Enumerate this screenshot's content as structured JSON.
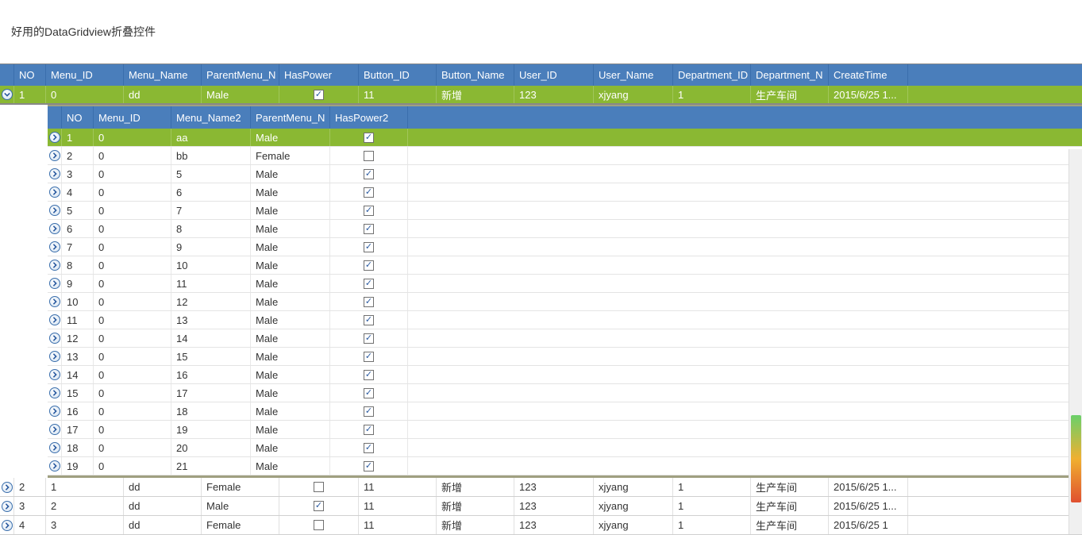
{
  "title": "好用的DataGridview折叠控件",
  "main_columns": {
    "no": "NO",
    "menu_id": "Menu_ID",
    "menu_name": "Menu_Name",
    "parentmenu_n": "ParentMenu_N",
    "haspower": "HasPower",
    "button_id": "Button_ID",
    "button_name": "Button_Name",
    "user_id": "User_ID",
    "user_name": "User_Name",
    "department_id": "Department_ID",
    "department_n": "Department_N",
    "createtime": "CreateTime"
  },
  "child_columns": {
    "no": "NO",
    "menu_id": "Menu_ID",
    "menu_name2": "Menu_Name2",
    "parentmenu_n": "ParentMenu_N",
    "haspower2": "HasPower2"
  },
  "main_rows": [
    {
      "no": "1",
      "menu_id": "0",
      "menu_name": "dd",
      "parentmenu_n": "Male",
      "haspower": true,
      "button_id": "11",
      "button_name": "新增",
      "user_id": "123",
      "user_name": "xjyang",
      "department_id": "1",
      "department_n": "生产车间",
      "createtime": "2015/6/25 1...",
      "selected": true,
      "expanded": true
    },
    {
      "no": "2",
      "menu_id": "1",
      "menu_name": "dd",
      "parentmenu_n": "Female",
      "haspower": false,
      "button_id": "11",
      "button_name": "新增",
      "user_id": "123",
      "user_name": "xjyang",
      "department_id": "1",
      "department_n": "生产车间",
      "createtime": "2015/6/25 1..."
    },
    {
      "no": "3",
      "menu_id": "2",
      "menu_name": "dd",
      "parentmenu_n": "Male",
      "haspower": true,
      "button_id": "11",
      "button_name": "新增",
      "user_id": "123",
      "user_name": "xjyang",
      "department_id": "1",
      "department_n": "生产车间",
      "createtime": "2015/6/25 1..."
    },
    {
      "no": "4",
      "menu_id": "3",
      "menu_name": "dd",
      "parentmenu_n": "Female",
      "haspower": false,
      "button_id": "11",
      "button_name": "新增",
      "user_id": "123",
      "user_name": "xjyang",
      "department_id": "1",
      "department_n": "生产车间",
      "createtime": "2015/6/25 1"
    }
  ],
  "child_rows": [
    {
      "no": "1",
      "menu_id": "0",
      "menu_name2": "aa",
      "parentmenu_n": "Male",
      "haspower2": true,
      "selected": true
    },
    {
      "no": "2",
      "menu_id": "0",
      "menu_name2": "bb",
      "parentmenu_n": "Female",
      "haspower2": false
    },
    {
      "no": "3",
      "menu_id": "0",
      "menu_name2": "5",
      "parentmenu_n": "Male",
      "haspower2": true
    },
    {
      "no": "4",
      "menu_id": "0",
      "menu_name2": "6",
      "parentmenu_n": "Male",
      "haspower2": true
    },
    {
      "no": "5",
      "menu_id": "0",
      "menu_name2": "7",
      "parentmenu_n": "Male",
      "haspower2": true
    },
    {
      "no": "6",
      "menu_id": "0",
      "menu_name2": "8",
      "parentmenu_n": "Male",
      "haspower2": true
    },
    {
      "no": "7",
      "menu_id": "0",
      "menu_name2": "9",
      "parentmenu_n": "Male",
      "haspower2": true
    },
    {
      "no": "8",
      "menu_id": "0",
      "menu_name2": "10",
      "parentmenu_n": "Male",
      "haspower2": true
    },
    {
      "no": "9",
      "menu_id": "0",
      "menu_name2": "11",
      "parentmenu_n": "Male",
      "haspower2": true
    },
    {
      "no": "10",
      "menu_id": "0",
      "menu_name2": "12",
      "parentmenu_n": "Male",
      "haspower2": true
    },
    {
      "no": "11",
      "menu_id": "0",
      "menu_name2": "13",
      "parentmenu_n": "Male",
      "haspower2": true
    },
    {
      "no": "12",
      "menu_id": "0",
      "menu_name2": "14",
      "parentmenu_n": "Male",
      "haspower2": true
    },
    {
      "no": "13",
      "menu_id": "0",
      "menu_name2": "15",
      "parentmenu_n": "Male",
      "haspower2": true
    },
    {
      "no": "14",
      "menu_id": "0",
      "menu_name2": "16",
      "parentmenu_n": "Male",
      "haspower2": true
    },
    {
      "no": "15",
      "menu_id": "0",
      "menu_name2": "17",
      "parentmenu_n": "Male",
      "haspower2": true
    },
    {
      "no": "16",
      "menu_id": "0",
      "menu_name2": "18",
      "parentmenu_n": "Male",
      "haspower2": true
    },
    {
      "no": "17",
      "menu_id": "0",
      "menu_name2": "19",
      "parentmenu_n": "Male",
      "haspower2": true
    },
    {
      "no": "18",
      "menu_id": "0",
      "menu_name2": "20",
      "parentmenu_n": "Male",
      "haspower2": true
    },
    {
      "no": "19",
      "menu_id": "0",
      "menu_name2": "21",
      "parentmenu_n": "Male",
      "haspower2": true
    }
  ]
}
